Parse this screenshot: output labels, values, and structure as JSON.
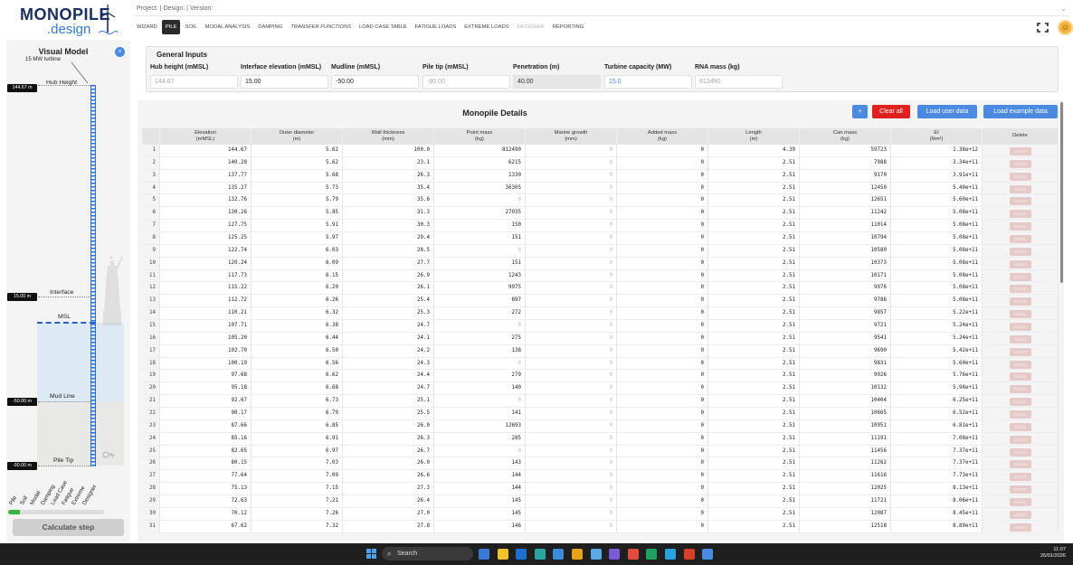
{
  "header": {
    "logo_top": "MONOPILE",
    "logo_bottom": ".design",
    "project_line": "Project: | Design: | Version:",
    "tabs": [
      {
        "label": "WIZARD",
        "state": "normal"
      },
      {
        "label": "PILE",
        "state": "active"
      },
      {
        "label": "SOIL",
        "state": "normal"
      },
      {
        "label": "MODAL ANALYSIS",
        "state": "normal"
      },
      {
        "label": "DAMPING",
        "state": "normal"
      },
      {
        "label": "TRANSFER FUNCTIONS",
        "state": "italic"
      },
      {
        "label": "LOAD CASE TABLE",
        "state": "normal"
      },
      {
        "label": "FATIGUE LOADS",
        "state": "normal"
      },
      {
        "label": "EXTREME LOADS",
        "state": "normal"
      },
      {
        "label": "DESIGNER",
        "state": "disabled"
      },
      {
        "label": "REPORTING",
        "state": "normal"
      }
    ],
    "icons": {
      "fullscreen": "fullscreen-icon",
      "user": "user-avatar-icon"
    }
  },
  "sidebar": {
    "title": "Visual Model",
    "close_symbol": "×",
    "turbine_label": "15 MW turbine",
    "levels": {
      "hub": {
        "name": "Hub Height",
        "value": "144.67 m"
      },
      "interface": {
        "name": "Interface",
        "value": "15.00 m"
      },
      "msl": {
        "name": "MSL"
      },
      "mudline": {
        "name": "Mud Line",
        "value": "-50.00 m"
      },
      "piletip": {
        "name": "Pile Tip",
        "value": "-90.00 m"
      }
    },
    "steps": [
      "Pile",
      "Soil",
      "Modal",
      "Damping",
      "Load Case",
      "Fatigue",
      "Extreme",
      "Designer"
    ],
    "progress": 0.12,
    "calculate_label": "Calculate step"
  },
  "general_inputs": {
    "title": "General Inputs",
    "fields": [
      {
        "label": "Hub height (mMSL)",
        "value": "144.67",
        "style": "ph"
      },
      {
        "label": "Interface elevation (mMSL)",
        "value": "15.00",
        "style": ""
      },
      {
        "label": "Mudline (mMSL)",
        "value": "-50.00",
        "style": ""
      },
      {
        "label": "Pile tip (mMSL)",
        "value": "-90.00",
        "style": "ph"
      },
      {
        "label": "Penetration (m)",
        "value": "40.00",
        "style": "ro"
      },
      {
        "label": "Turbine capacity (MW)",
        "value": "15.0",
        "style": "blue"
      },
      {
        "label": "RNA mass (kg)",
        "value": "812490",
        "style": "ph"
      }
    ]
  },
  "details": {
    "title": "Monopile Details",
    "buttons": {
      "add": "+",
      "clear": "Clear all",
      "load_user": "Load user data",
      "load_example": "Load example data"
    },
    "columns": [
      [
        "",
        ""
      ],
      [
        "Elevation",
        "(mMSL)"
      ],
      [
        "Outer diameter",
        "(m)"
      ],
      [
        "Wall thickness",
        "(mm)"
      ],
      [
        "Point mass",
        "(kg)"
      ],
      [
        "Marine growth",
        "(mm)"
      ],
      [
        "Added mass",
        "(kg)"
      ],
      [
        "Length",
        "(m)"
      ],
      [
        "Can mass",
        "(kg)"
      ],
      [
        "EI",
        "(Nm²)"
      ],
      [
        "Delete",
        ""
      ]
    ],
    "delete_label": "Delete",
    "rows": [
      [
        "1",
        "144.67",
        "5.62",
        "100.0",
        "812490",
        "0",
        "0",
        "4.39",
        "59723",
        "1.38e+12"
      ],
      [
        "2",
        "140.28",
        "5.62",
        "23.1",
        "6215",
        "0",
        "0",
        "2.51",
        "7988",
        "3.34e+11"
      ],
      [
        "3",
        "137.77",
        "5.68",
        "26.3",
        "1330",
        "0",
        "0",
        "2.51",
        "9170",
        "3.91e+11"
      ],
      [
        "4",
        "135.27",
        "5.73",
        "35.4",
        "36305",
        "0",
        "0",
        "2.51",
        "12459",
        "5.40e+11"
      ],
      [
        "5",
        "132.76",
        "5.79",
        "35.6",
        "0",
        "0",
        "0",
        "2.51",
        "12651",
        "5.60e+11"
      ],
      [
        "6",
        "130.26",
        "5.85",
        "31.3",
        "27035",
        "0",
        "0",
        "2.51",
        "11242",
        "5.08e+11"
      ],
      [
        "7",
        "127.75",
        "5.91",
        "30.3",
        "150",
        "0",
        "0",
        "2.51",
        "11014",
        "5.08e+11"
      ],
      [
        "8",
        "125.25",
        "5.97",
        "29.4",
        "151",
        "0",
        "0",
        "2.51",
        "10794",
        "5.08e+11"
      ],
      [
        "9",
        "122.74",
        "6.03",
        "28.5",
        "0",
        "0",
        "0",
        "2.51",
        "10580",
        "5.08e+11"
      ],
      [
        "10",
        "120.24",
        "6.09",
        "27.7",
        "151",
        "0",
        "0",
        "2.51",
        "10373",
        "5.08e+11"
      ],
      [
        "11",
        "117.73",
        "6.15",
        "26.9",
        "1243",
        "0",
        "0",
        "2.51",
        "10171",
        "5.08e+11"
      ],
      [
        "12",
        "115.22",
        "6.20",
        "26.1",
        "9975",
        "0",
        "0",
        "2.51",
        "9976",
        "5.08e+11"
      ],
      [
        "13",
        "112.72",
        "6.26",
        "25.4",
        "897",
        "0",
        "0",
        "2.51",
        "9786",
        "5.08e+11"
      ],
      [
        "14",
        "110.21",
        "6.32",
        "25.3",
        "272",
        "0",
        "0",
        "2.51",
        "9857",
        "5.22e+11"
      ],
      [
        "15",
        "107.71",
        "6.38",
        "24.7",
        "0",
        "0",
        "0",
        "2.51",
        "9721",
        "5.24e+11"
      ],
      [
        "16",
        "105.20",
        "6.44",
        "24.1",
        "275",
        "0",
        "0",
        "2.51",
        "9541",
        "5.24e+11"
      ],
      [
        "17",
        "102.70",
        "6.50",
        "24.2",
        "138",
        "0",
        "0",
        "2.51",
        "9690",
        "5.42e+11"
      ],
      [
        "18",
        "100.19",
        "6.56",
        "24.3",
        "0",
        "0",
        "0",
        "2.51",
        "9831",
        "5.60e+11"
      ],
      [
        "19",
        "97.68",
        "6.62",
        "24.4",
        "279",
        "0",
        "0",
        "2.51",
        "9926",
        "5.76e+11"
      ],
      [
        "20",
        "95.18",
        "6.68",
        "24.7",
        "140",
        "0",
        "0",
        "2.51",
        "10132",
        "5.98e+11"
      ],
      [
        "21",
        "92.67",
        "6.73",
        "25.1",
        "0",
        "0",
        "0",
        "2.51",
        "10404",
        "6.25e+11"
      ],
      [
        "22",
        "90.17",
        "6.79",
        "25.5",
        "141",
        "0",
        "0",
        "2.51",
        "10665",
        "6.52e+11"
      ],
      [
        "23",
        "87.66",
        "6.85",
        "26.0",
        "12693",
        "0",
        "0",
        "2.51",
        "10951",
        "6.81e+11"
      ],
      [
        "24",
        "85.16",
        "6.91",
        "26.3",
        "285",
        "0",
        "0",
        "2.51",
        "11191",
        "7.08e+11"
      ],
      [
        "25",
        "82.65",
        "6.97",
        "26.7",
        "0",
        "0",
        "0",
        "2.51",
        "11456",
        "7.37e+11"
      ],
      [
        "26",
        "80.15",
        "7.03",
        "26.0",
        "143",
        "0",
        "0",
        "2.51",
        "11262",
        "7.37e+11"
      ],
      [
        "27",
        "77.64",
        "7.09",
        "26.6",
        "144",
        "0",
        "0",
        "2.51",
        "11616",
        "7.73e+11"
      ],
      [
        "28",
        "75.13",
        "7.15",
        "27.3",
        "144",
        "0",
        "0",
        "2.51",
        "12025",
        "8.13e+11"
      ],
      [
        "29",
        "72.63",
        "7.21",
        "26.4",
        "145",
        "0",
        "0",
        "2.51",
        "11721",
        "8.06e+11"
      ],
      [
        "30",
        "70.12",
        "7.26",
        "27.0",
        "145",
        "0",
        "0",
        "2.51",
        "12087",
        "8.45e+11"
      ],
      [
        "31",
        "67.62",
        "7.32",
        "27.8",
        "146",
        "0",
        "0",
        "2.51",
        "12518",
        "8.89e+11"
      ]
    ]
  },
  "taskbar": {
    "search_label": "Search",
    "time": "11:07",
    "date": "26/01/2026",
    "icon_colors": [
      "#3b7bd8",
      "#f2c12e",
      "#1f6fd1",
      "#2aa5a1",
      "#3c8cd9",
      "#e8a21c",
      "#5aa9e6",
      "#7b5cd6",
      "#e34b3f",
      "#22a060",
      "#2aa2e0",
      "#d6402b",
      "#4b8ae0"
    ]
  }
}
